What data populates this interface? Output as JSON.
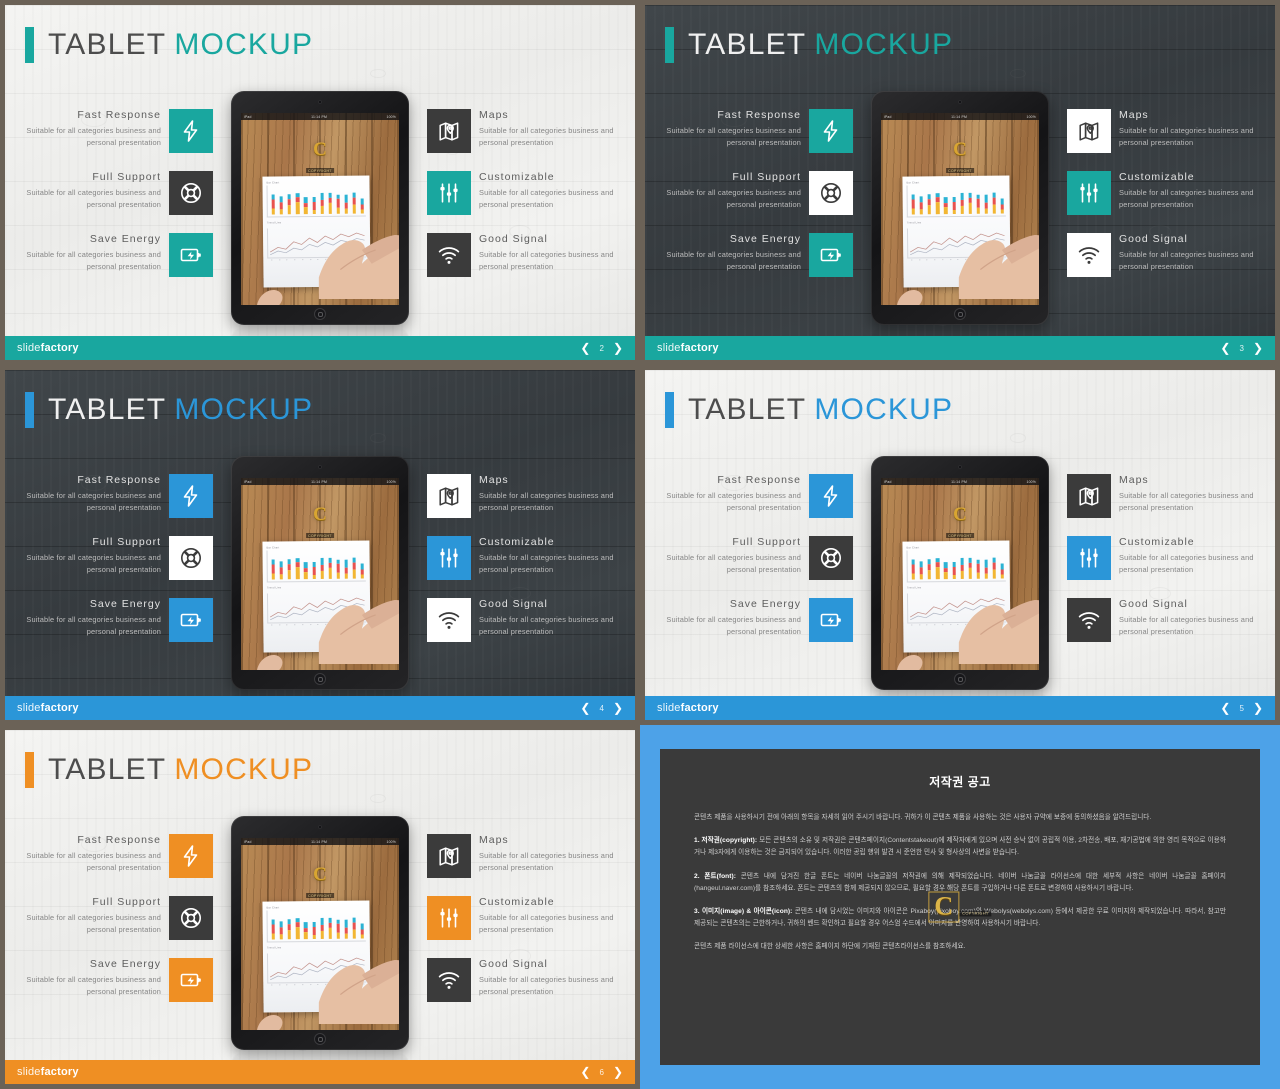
{
  "common": {
    "title_part1": "TABLET",
    "title_part2": "MOCKUP",
    "brand_thin": "slide",
    "brand_bold": "factory",
    "prev_arrow": "❮",
    "next_arrow": "❯",
    "features_left": [
      {
        "title": "Fast Response",
        "desc": "Suitable for all categories business and personal presentation",
        "icon": "bolt-icon"
      },
      {
        "title": "Full Support",
        "desc": "Suitable for all categories business and personal presentation",
        "icon": "lifebuoy-icon"
      },
      {
        "title": "Save Energy",
        "desc": "Suitable for all categories business and personal presentation",
        "icon": "battery-charge-icon"
      }
    ],
    "features_right": [
      {
        "title": "Maps",
        "desc": "Suitable for all categories business and personal presentation",
        "icon": "map-pin-icon"
      },
      {
        "title": "Customizable",
        "desc": "Suitable for all categories business and personal presentation",
        "icon": "sliders-icon"
      },
      {
        "title": "Good Signal",
        "desc": "Suitable for all categories business and personal presentation",
        "icon": "wifi-icon"
      }
    ],
    "tablet": {
      "status_left": "iPad",
      "status_center": "11:14 PM",
      "status_right": "100%",
      "screen_label_top": "Bar Chart",
      "screen_label_bottom": "Trend Line",
      "watermark_letter": "C",
      "watermark_sub": "COPYRIGHT"
    }
  },
  "slides": [
    {
      "id": "slide-teal-light",
      "theme": "light",
      "accent": "#19a79f",
      "dark_box": "#3b3b3b",
      "title_accent_color": "#19a79f",
      "page_number": "2",
      "left_filled": [
        true,
        false,
        true
      ],
      "right_filled": [
        false,
        true,
        false
      ]
    },
    {
      "id": "slide-teal-dark",
      "theme": "dark",
      "accent": "#19a79f",
      "dark_box": "#ffffff",
      "title_accent_color": "#19a79f",
      "page_number": "3",
      "left_filled": [
        true,
        false,
        true
      ],
      "right_filled": [
        false,
        true,
        false
      ]
    },
    {
      "id": "slide-blue-dark",
      "theme": "dark",
      "accent": "#2b96d8",
      "dark_box": "#ffffff",
      "title_accent_color": "#2b96d8",
      "page_number": "4",
      "left_filled": [
        true,
        false,
        true
      ],
      "right_filled": [
        false,
        true,
        false
      ]
    },
    {
      "id": "slide-blue-light",
      "theme": "light",
      "accent": "#2b96d8",
      "dark_box": "#3b3b3b",
      "title_accent_color": "#2b96d8",
      "page_number": "5",
      "left_filled": [
        true,
        false,
        true
      ],
      "right_filled": [
        false,
        true,
        false
      ]
    },
    {
      "id": "slide-orange-light",
      "theme": "light",
      "accent": "#ef8f23",
      "dark_box": "#3b3b3b",
      "title_accent_color": "#ef8f23",
      "page_number": "6",
      "left_filled": [
        true,
        false,
        true
      ],
      "right_filled": [
        false,
        true,
        false
      ]
    }
  ],
  "copyright_panel": {
    "frame_color": "#4da2e8",
    "panel_color": "#3a3a3a",
    "title": "저작권 공고",
    "intro": "콘텐츠 제품을 사용하시기 전에 아래의 항목을 자세히 읽어 주시기 바랍니다. 귀하가 이 콘텐츠 제품을 사용하는 것은 사용자 규약에 보증에 동의하셨음을 알려드립니다.",
    "sections": [
      {
        "label": "1. 저작권(copyright):",
        "body": " 모든 콘텐츠의 소유 및 저작권은 콘텐츠페이지(Contentstakeout)에 제작자에게 있으며 사전 승낙 없이 공립적 이용, 2차전송, 배포, 재기공법에 의한 영리 목적으로 이용하거나 제3자에게 이용하는 것은 금지되어 있습니다. 이러한 공립 행위 발견 시 준언한 민사 및 형사상의 사변을 받습니다."
      },
      {
        "label": "2. 폰트(font):",
        "body": " 콘텐츠 내에 담겨진 한글 폰트는 네이버 나눔글꼴의 저작권에 의해 제작되었습니다. 네이버 나눔글꼴 라이선스에 대한 세부적 사항은 네이버 나눔글꼴 홈페이지(hangeul.naver.com)를 참조하세요. 폰트는 콘텐츠의 함께 제공되지 않으므로, 필요할 경우 해당 폰트를 구입하거나 다른 폰트로 변경하여 사용하시기 바랍니다."
      },
      {
        "label": "3. 이미지(image) & 아이콘(icon):",
        "body": " 콘텐츠 내에 담시었는 이미지와 아이콘은 Pixaboy(pixoboy.com)와 Webolys(webolys.com) 등에서 제공한 무료 이미지와 제작되었습니다. 따라서, 참고만 제공되는 콘텐츠의는 근한하거나, 귀하의 벤드 확인하고 필요할 경우 어스엄 수드에서 이미지를 반영하여 사용하시기 바랍니다."
      }
    ],
    "footer_note": "콘텐츠 제품 라이선스에 대한 상세한 사항은 홈페이지 하단에 기재된 콘텐츠라이선스를 참조하세요.",
    "watermark_letter": "C",
    "watermark_sub": "COPYRIGHT"
  }
}
